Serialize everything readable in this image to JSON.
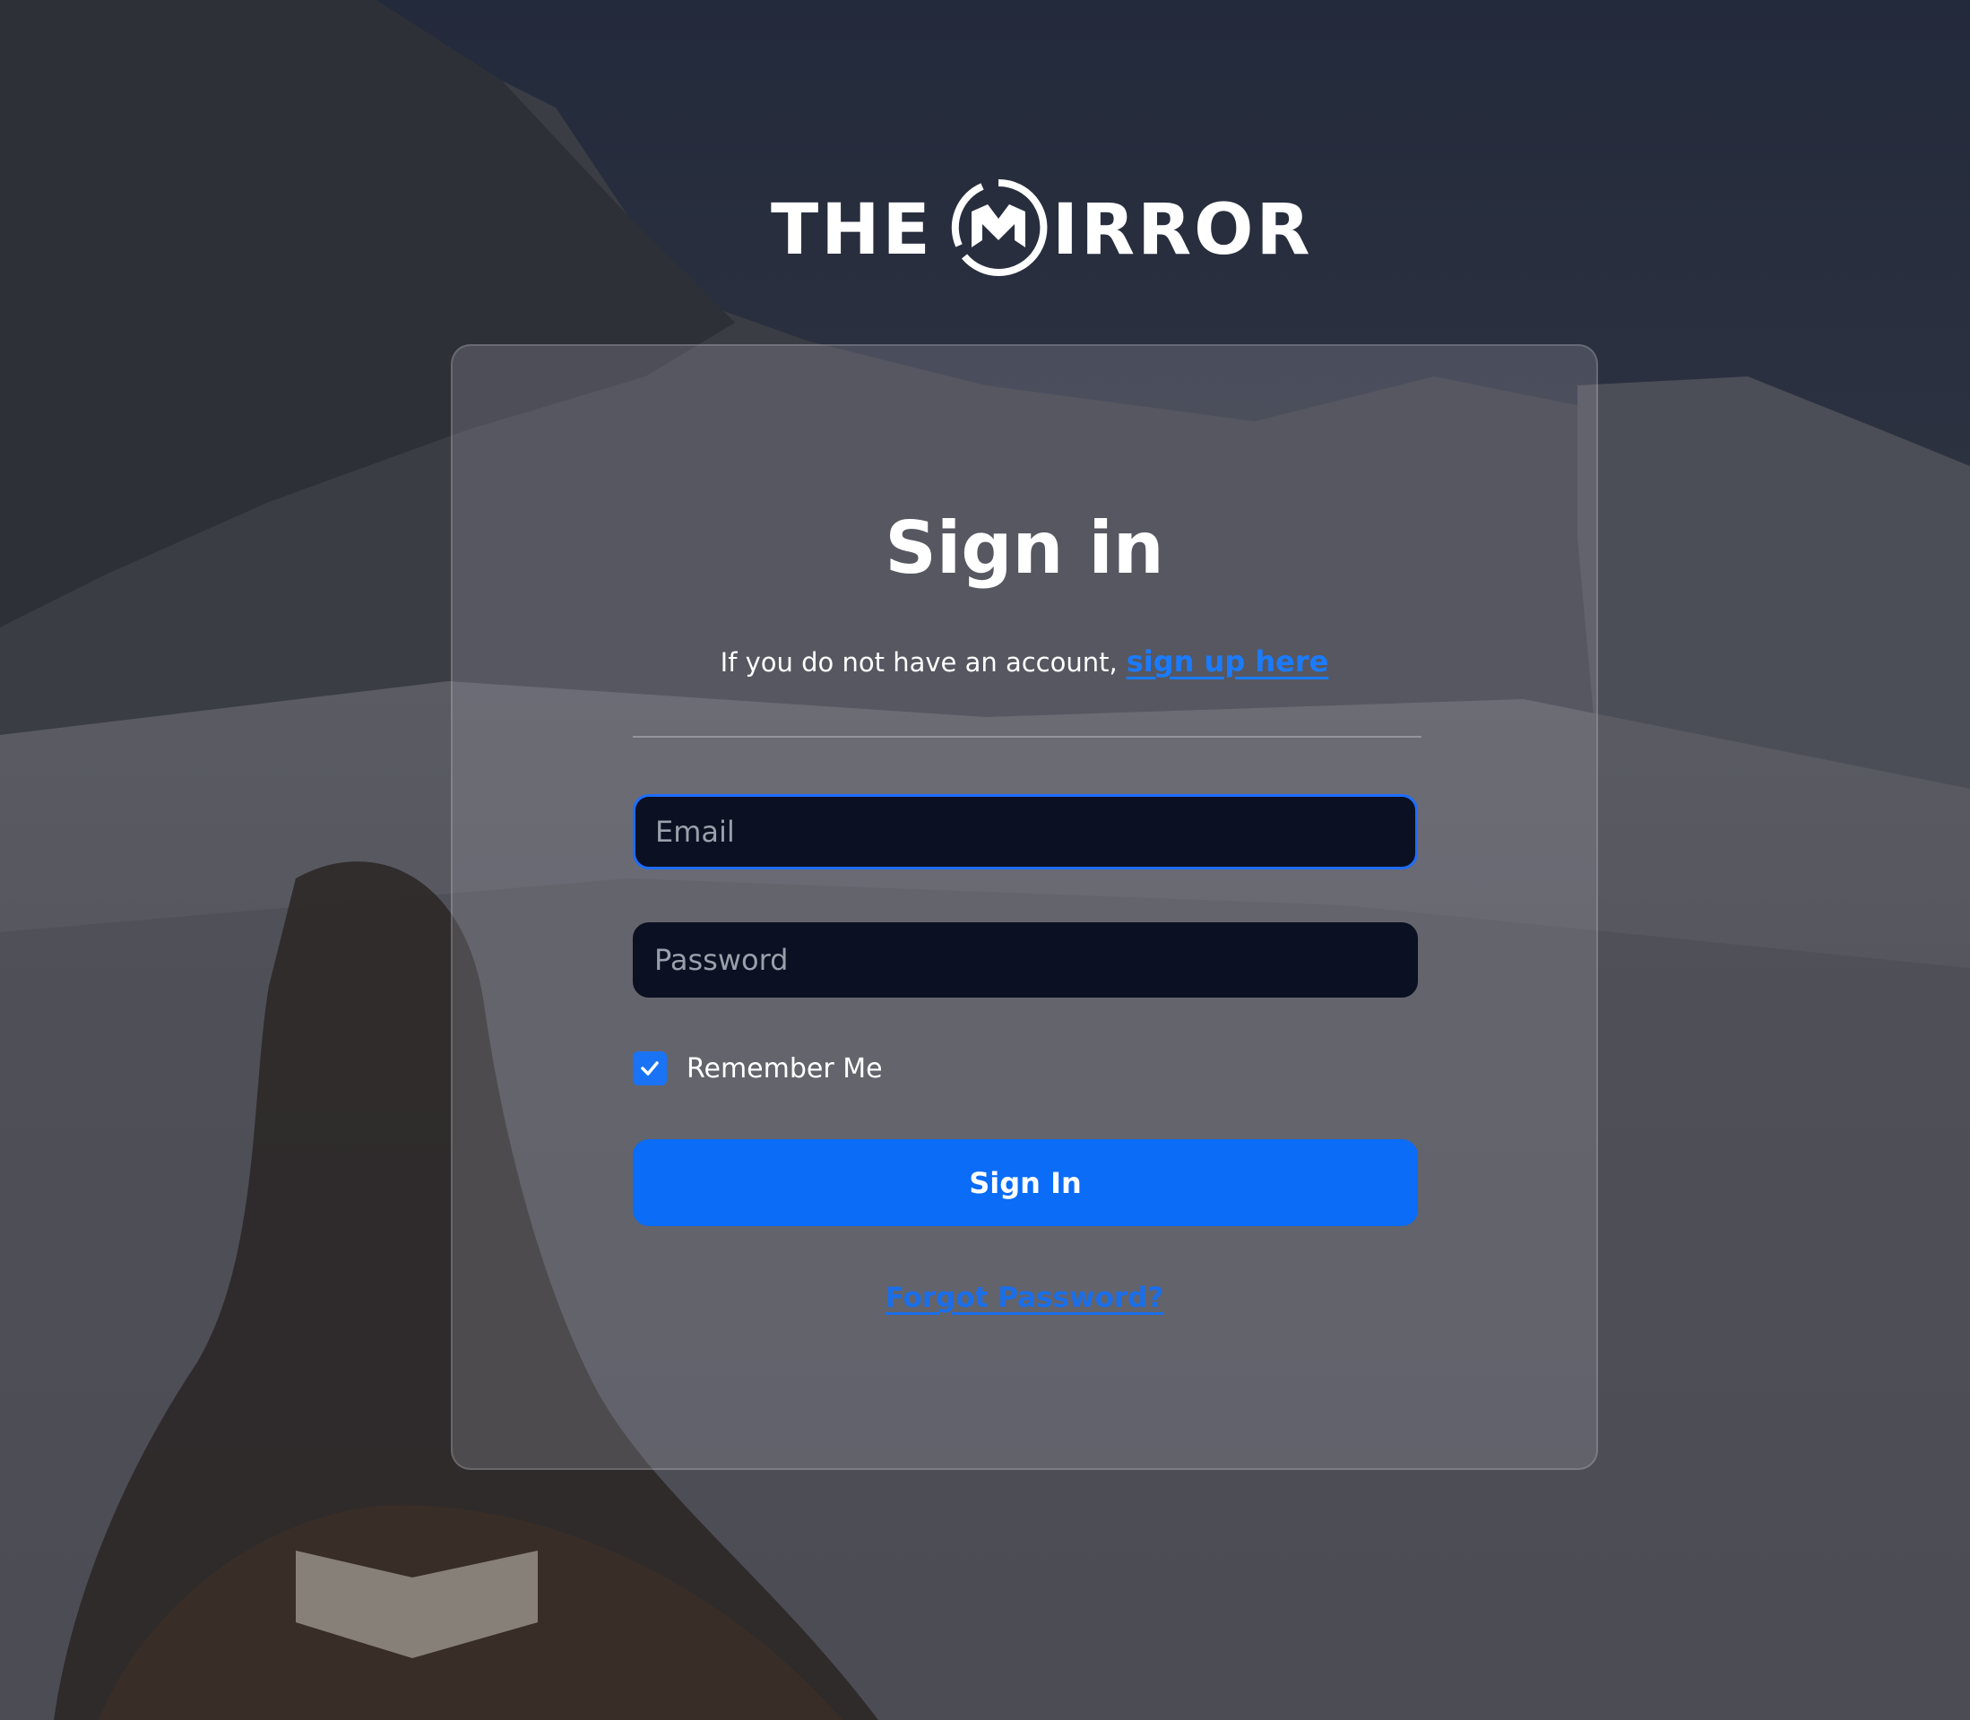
{
  "brand": {
    "word_left": "THE",
    "word_right": "IRROR",
    "emblem_icon": "mirror-m-emblem-icon"
  },
  "signin": {
    "title": "Sign in",
    "signup_prompt": "If you do not have an account,",
    "signup_link": "sign up here",
    "email_placeholder": "Email",
    "email_value": "",
    "password_placeholder": "Password",
    "password_value": "",
    "remember_label": "Remember Me",
    "remember_checked": true,
    "submit_label": "Sign In",
    "forgot_label": "Forgot Password?"
  },
  "colors": {
    "accent": "#0a6cf7",
    "link": "#1a7bff",
    "input_bg": "#0b1022",
    "focus_border": "#1f6dff"
  }
}
